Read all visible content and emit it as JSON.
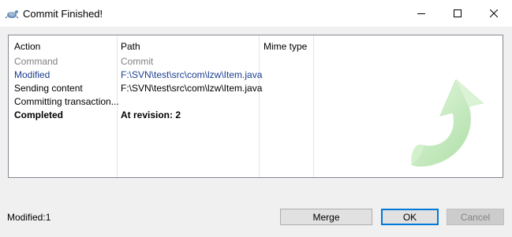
{
  "window": {
    "title": "Commit Finished!",
    "icon": "tortoisesvn-icon"
  },
  "list": {
    "columns": [
      "Action",
      "Path",
      "Mime type"
    ],
    "rows": [
      {
        "action": "Command",
        "path": "Commit",
        "style": "gray"
      },
      {
        "action": "Modified",
        "path": "F:\\SVN\\test\\src\\com\\lzw\\Item.java",
        "style": "blue"
      },
      {
        "action": "Sending content",
        "path": "F:\\SVN\\test\\src\\com\\lzw\\Item.java",
        "style": "normal"
      },
      {
        "action": "Committing transaction...",
        "path": "",
        "style": "normal"
      },
      {
        "action": "Completed",
        "path": "At revision: 2",
        "style": "bold"
      }
    ]
  },
  "decoration": {
    "icon": "green-curved-arrow-icon",
    "color": "#b8e8b0"
  },
  "status": {
    "text": "Modified:1"
  },
  "buttons": {
    "merge": "Merge",
    "ok": "OK",
    "cancel": "Cancel"
  },
  "colors": {
    "modified_text": "#1a3d8f",
    "command_text": "#808080",
    "ok_border": "#0078d7"
  }
}
